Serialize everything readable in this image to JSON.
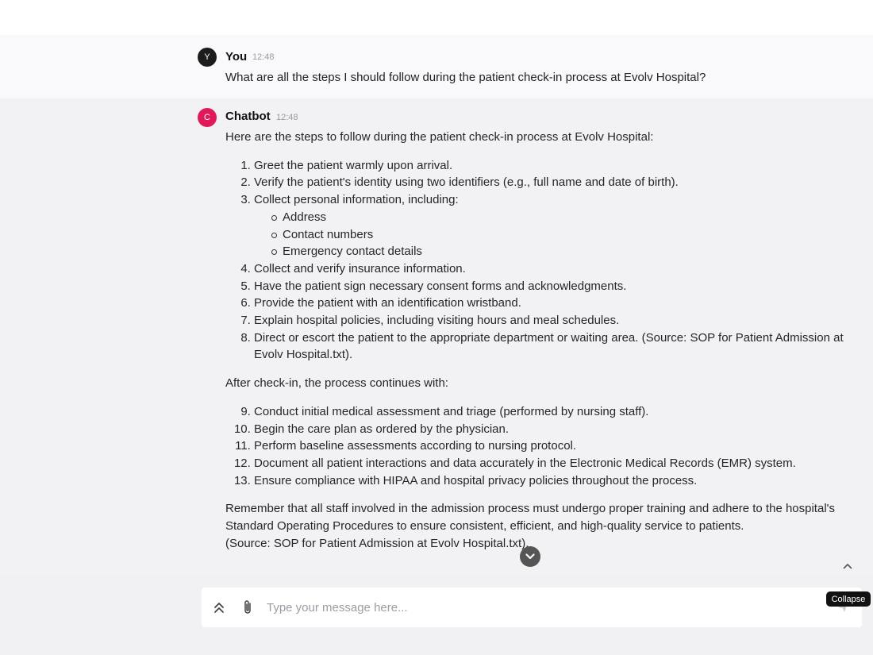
{
  "conversation": {
    "user": {
      "initial": "Y",
      "name": "You",
      "time": "12:48",
      "text": "What are all the steps I should follow during the patient check-in process at Evolv Hospital?"
    },
    "bot": {
      "initial": "C",
      "name": "Chatbot",
      "time": "12:48",
      "intro": "Here are the steps to follow during the patient check-in process at Evolv Hospital:",
      "steps": [
        "Greet the patient warmly upon arrival.",
        "Verify the patient's identity using two identifiers (e.g., full name and date of birth).",
        "Collect personal information, including:",
        "Collect and verify insurance information.",
        "Have the patient sign necessary consent forms and acknowledgments.",
        "Provide the patient with an identification wristband.",
        "Explain hospital policies, including visiting hours and meal schedules.",
        "Direct or escort the patient to the appropriate department or waiting area. (Source: SOP for Patient Admission at Evolv Hospital.txt)."
      ],
      "sub_items": [
        "Address",
        "Contact numbers",
        "Emergency contact details"
      ],
      "continuation": "After check-in, the process continues with:",
      "steps_after": [
        "Conduct initial medical assessment and triage (performed by nursing staff).",
        "Begin the care plan as ordered by the physician.",
        "Perform baseline assessments according to nursing protocol.",
        "Document all patient interactions and data accurately in the Electronic Medical Records (EMR) system.",
        "Ensure compliance with HIPAA and hospital privacy policies throughout the process."
      ],
      "closing": "Remember that all staff involved in the admission process must undergo proper training and adhere to the hospital's Standard Operating Procedures to ensure consistent, efficient, and high-quality service to patients.",
      "closing_source": "(Source: SOP for Patient Admission at Evolv Hospital.txt)."
    }
  },
  "composer": {
    "placeholder": "Type your message here...",
    "tooltip": "Collapse"
  },
  "colors": {
    "bot_avatar": "#e0195a",
    "user_avatar": "#1c1c1c"
  },
  "icons": {
    "expand": "double-chevron-up-icon",
    "attach": "paperclip-icon",
    "send": "send-icon",
    "scroll_down": "chevron-down-circle-icon",
    "collapse": "chevron-up-icon"
  }
}
